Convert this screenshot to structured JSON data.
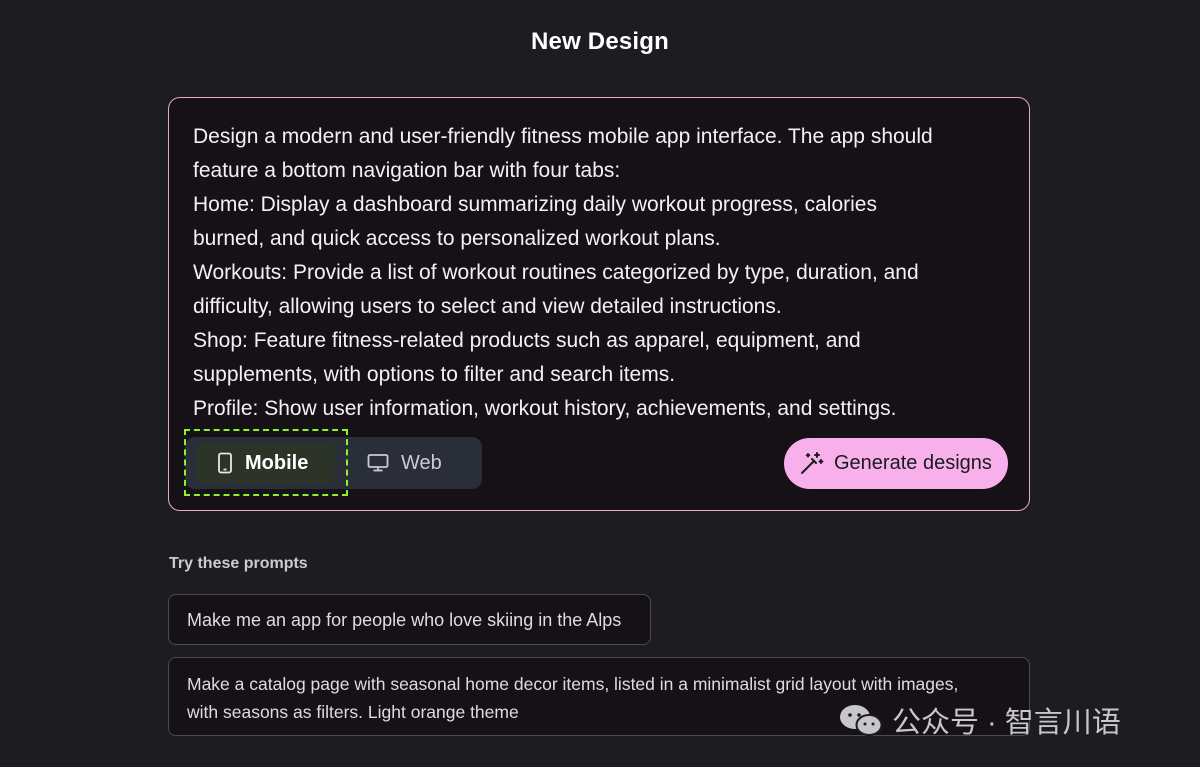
{
  "header": {
    "title": "New Design"
  },
  "prompt": {
    "text": "Design a modern and user-friendly fitness mobile app interface. The app should\nfeature a bottom navigation bar with four tabs:\nHome: Display a dashboard summarizing daily workout progress, calories\nburned, and quick access to personalized workout plans.\nWorkouts: Provide a list of workout routines categorized by type, duration, and\ndifficulty, allowing users to select and view detailed instructions.\nShop: Feature fitness-related products such as apparel, equipment, and\nsupplements, with options to filter and search items.\nProfile: Show user information, workout history, achievements, and settings."
  },
  "device_toggle": {
    "mobile_label": "Mobile",
    "web_label": "Web",
    "selected": "Mobile"
  },
  "generate": {
    "label": "Generate designs"
  },
  "suggestions": {
    "heading": "Try these prompts",
    "items": [
      {
        "text": "Make me an app for people who love skiing in the Alps"
      },
      {
        "text": "Make a catalog page with seasonal home decor items, listed in a minimalist grid layout with images,\nwith seasons as filters. Light orange theme"
      }
    ]
  },
  "watermark": {
    "text": "公众号 · 智言川语"
  },
  "colors": {
    "background": "#1c1c21",
    "accent": "#f8b0ea",
    "prompt_border": "#e3a8d6",
    "focus_outline": "#8cf22a"
  },
  "icons": {
    "mobile": "smartphone-icon",
    "web": "monitor-icon",
    "generate": "magic-wand-icon",
    "watermark": "wechat-icon"
  }
}
